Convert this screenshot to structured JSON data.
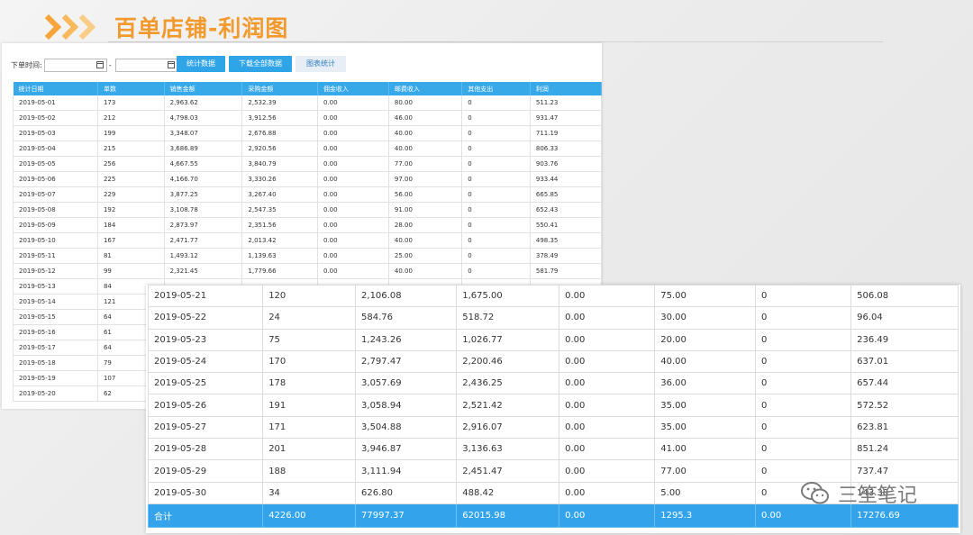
{
  "title": "百单店铺-利润图",
  "filter": {
    "label": "下单时间:",
    "separator": "-",
    "start_value": "",
    "end_value": ""
  },
  "buttons": {
    "stats": "统计数据",
    "download": "下载全部数据",
    "chart": "图表统计"
  },
  "back_table": {
    "headers": [
      "统计日期",
      "单数",
      "销售金额",
      "采购金额",
      "佣金收入",
      "邮费收入",
      "其他支出",
      "利润"
    ],
    "rows": [
      [
        "2019-05-01",
        "173",
        "2,963.62",
        "2,532.39",
        "0.00",
        "80.00",
        "0",
        "511.23"
      ],
      [
        "2019-05-02",
        "212",
        "4,798.03",
        "3,912.56",
        "0.00",
        "46.00",
        "0",
        "931.47"
      ],
      [
        "2019-05-03",
        "199",
        "3,348.07",
        "2,676.88",
        "0.00",
        "40.00",
        "0",
        "711.19"
      ],
      [
        "2019-05-04",
        "215",
        "3,686.89",
        "2,920.56",
        "0.00",
        "40.00",
        "0",
        "806.33"
      ],
      [
        "2019-05-05",
        "256",
        "4,667.55",
        "3,840.79",
        "0.00",
        "77.00",
        "0",
        "903.76"
      ],
      [
        "2019-05-06",
        "225",
        "4,166.70",
        "3,330.26",
        "0.00",
        "97.00",
        "0",
        "933.44"
      ],
      [
        "2019-05-07",
        "229",
        "3,877.25",
        "3,267.40",
        "0.00",
        "56.00",
        "0",
        "665.85"
      ],
      [
        "2019-05-08",
        "192",
        "3,108.78",
        "2,547.35",
        "0.00",
        "91.00",
        "0",
        "652.43"
      ],
      [
        "2019-05-09",
        "184",
        "2,873.97",
        "2,351.56",
        "0.00",
        "28.00",
        "0",
        "550.41"
      ],
      [
        "2019-05-10",
        "167",
        "2,471.77",
        "2,013.42",
        "0.00",
        "40.00",
        "0",
        "498.35"
      ],
      [
        "2019-05-11",
        "81",
        "1,493.12",
        "1,139.63",
        "0.00",
        "25.00",
        "0",
        "378.49"
      ],
      [
        "2019-05-12",
        "99",
        "2,321.45",
        "1,779.66",
        "0.00",
        "40.00",
        "0",
        "581.79"
      ],
      [
        "2019-05-13",
        "84",
        "",
        "",
        "",
        "",
        "",
        ""
      ],
      [
        "2019-05-14",
        "121",
        "",
        "",
        "",
        "",
        "",
        ""
      ],
      [
        "2019-05-15",
        "64",
        "",
        "",
        "",
        "",
        "",
        ""
      ],
      [
        "2019-05-16",
        "61",
        "",
        "",
        "",
        "",
        "",
        ""
      ],
      [
        "2019-05-17",
        "64",
        "",
        "",
        "",
        "",
        "",
        ""
      ],
      [
        "2019-05-18",
        "79",
        "",
        "",
        "",
        "",
        "",
        ""
      ],
      [
        "2019-05-19",
        "107",
        "",
        "",
        "",
        "",
        "",
        ""
      ],
      [
        "2019-05-20",
        "62",
        "",
        "",
        "",
        "",
        "",
        ""
      ]
    ]
  },
  "front_table": {
    "rows": [
      [
        "2019-05-21",
        "120",
        "2,106.08",
        "1,675.00",
        "0.00",
        "75.00",
        "0",
        "506.08"
      ],
      [
        "2019-05-22",
        "24",
        "584.76",
        "518.72",
        "0.00",
        "30.00",
        "0",
        "96.04"
      ],
      [
        "2019-05-23",
        "75",
        "1,243.26",
        "1,026.77",
        "0.00",
        "20.00",
        "0",
        "236.49"
      ],
      [
        "2019-05-24",
        "170",
        "2,797.47",
        "2,200.46",
        "0.00",
        "40.00",
        "0",
        "637.01"
      ],
      [
        "2019-05-25",
        "178",
        "3,057.69",
        "2,436.25",
        "0.00",
        "36.00",
        "0",
        "657.44"
      ],
      [
        "2019-05-26",
        "191",
        "3,058.94",
        "2,521.42",
        "0.00",
        "35.00",
        "0",
        "572.52"
      ],
      [
        "2019-05-27",
        "171",
        "3,504.88",
        "2,916.07",
        "0.00",
        "35.00",
        "0",
        "623.81"
      ],
      [
        "2019-05-28",
        "201",
        "3,946.87",
        "3,136.63",
        "0.00",
        "41.00",
        "0",
        "851.24"
      ],
      [
        "2019-05-29",
        "188",
        "3,111.94",
        "2,451.47",
        "0.00",
        "77.00",
        "0",
        "737.47"
      ],
      [
        "2019-05-30",
        "34",
        "626.80",
        "488.42",
        "0.00",
        "5.00",
        "0",
        "143.38"
      ]
    ],
    "total": [
      "合计",
      "4226.00",
      "77997.37",
      "62015.98",
      "0.00",
      "1295.3",
      "0.00",
      "17276.69"
    ]
  },
  "watermark": "三笙笔记",
  "colors": {
    "accent_orange": "#f29a2e",
    "header_blue": "#37a8e8",
    "total_blue": "#33a4ec"
  }
}
